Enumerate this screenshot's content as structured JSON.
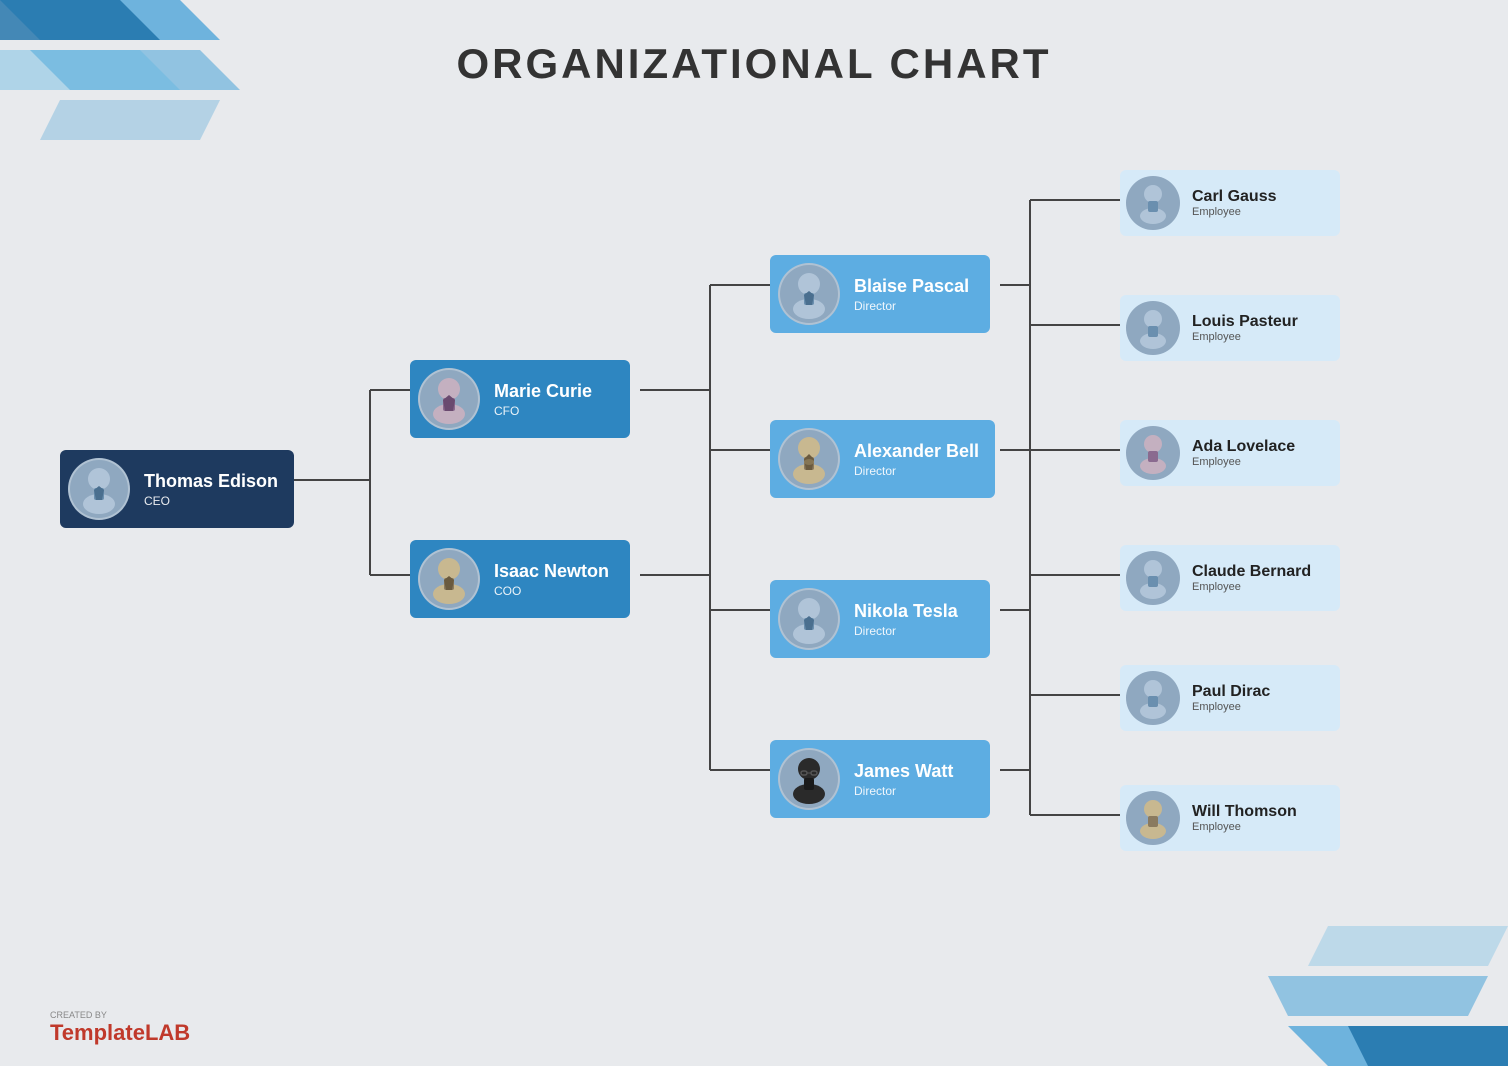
{
  "title": "ORGANIZATIONAL CHART",
  "colors": {
    "dark_node": "#1e3a5f",
    "blue_node": "#2e86c1",
    "light_node": "#5dade2",
    "emp_bg": "#d6eaf8",
    "connector": "#444"
  },
  "nodes": {
    "ceo": {
      "name": "Thomas Edison",
      "title": "CEO",
      "style": "dark"
    },
    "cfo": {
      "name": "Marie Curie",
      "title": "CFO",
      "style": "blue"
    },
    "coo": {
      "name": "Isaac Newton",
      "title": "COO",
      "style": "blue"
    },
    "directors": [
      {
        "id": "pascal",
        "name": "Blaise Pascal",
        "title": "Director"
      },
      {
        "id": "bell",
        "name": "Alexander Bell",
        "title": "Director"
      },
      {
        "id": "tesla",
        "name": "Nikola Tesla",
        "title": "Director"
      },
      {
        "id": "watt",
        "name": "James Watt",
        "title": "Director"
      }
    ],
    "employees": [
      {
        "id": "gauss",
        "name": "Carl Gauss",
        "title": "Employee"
      },
      {
        "id": "pasteur",
        "name": "Louis Pasteur",
        "title": "Employee"
      },
      {
        "id": "lovelace",
        "name": "Ada Lovelace",
        "title": "Employee"
      },
      {
        "id": "bernard",
        "name": "Claude Bernard",
        "title": "Employee"
      },
      {
        "id": "dirac",
        "name": "Paul Dirac",
        "title": "Employee"
      },
      {
        "id": "thomson",
        "name": "Will Thomson",
        "title": "Employee"
      }
    ]
  },
  "logo": {
    "created_by": "CREATED BY",
    "brand_regular": "Template",
    "brand_bold": "LAB"
  }
}
